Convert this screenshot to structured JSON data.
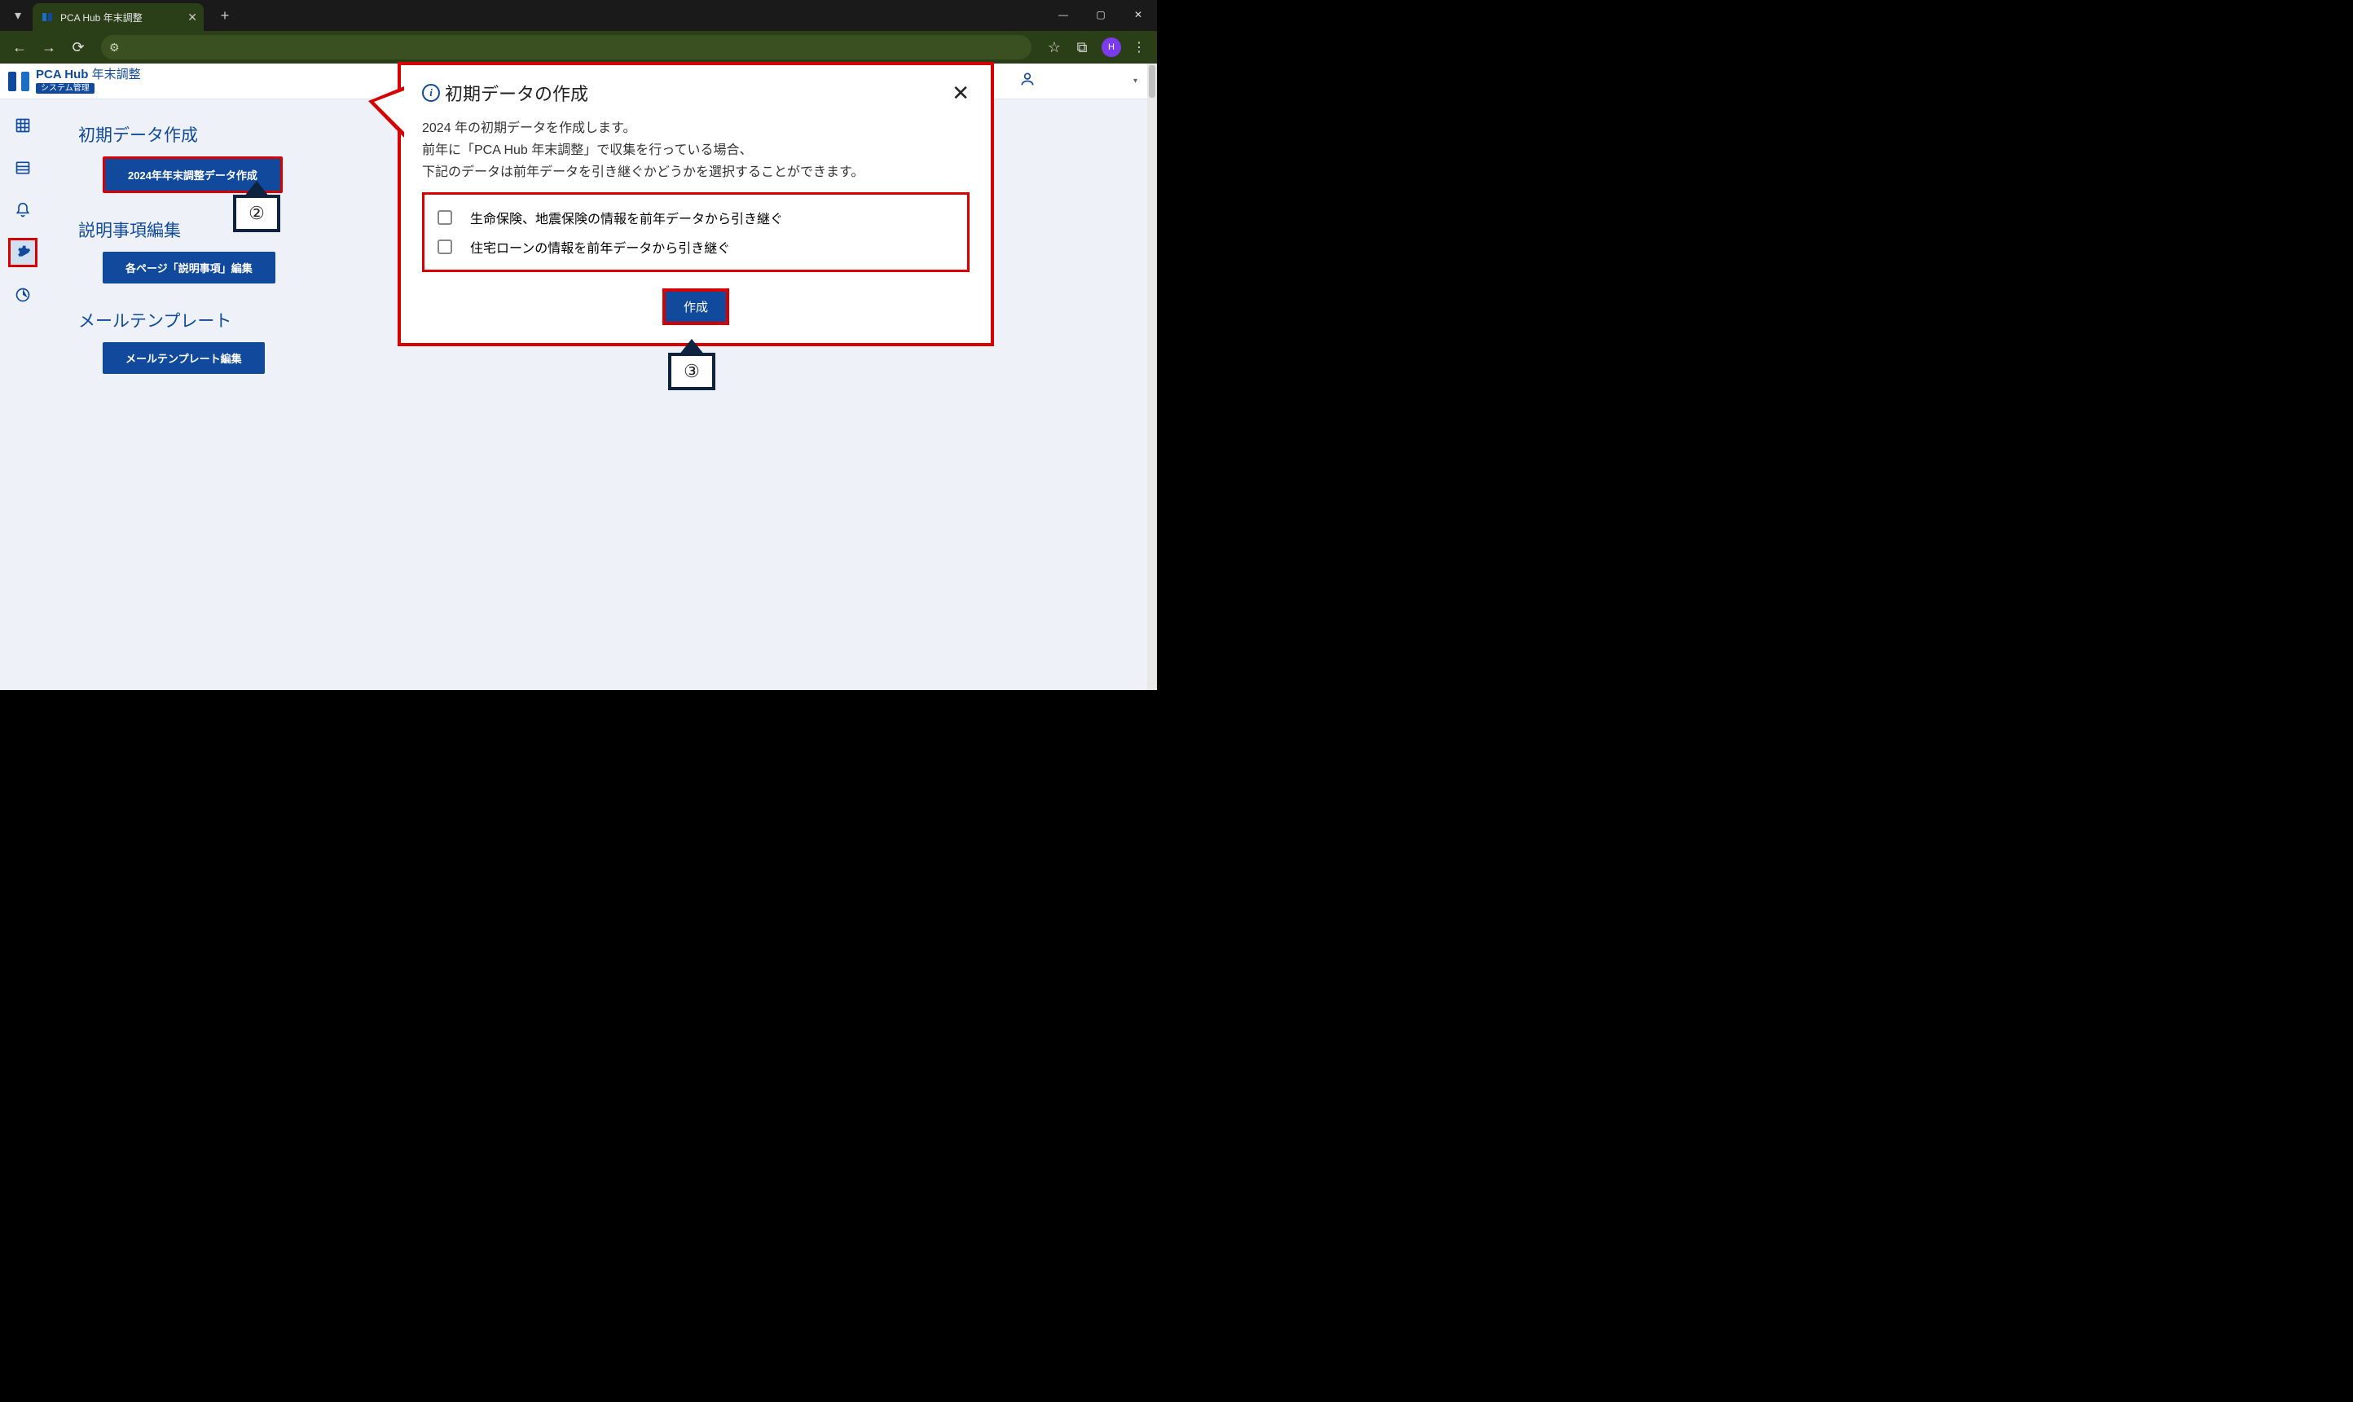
{
  "browser": {
    "tab_title": "PCA Hub 年末調整",
    "profile_initial": "H"
  },
  "app_header": {
    "brand": "PCA Hub",
    "brand_tail": "年末調整",
    "sub_label": "システム管理"
  },
  "sidebar": {
    "items": [
      {
        "name": "grid-icon"
      },
      {
        "name": "list-icon"
      },
      {
        "name": "bell-icon"
      },
      {
        "name": "gear-icon",
        "active": true
      },
      {
        "name": "pie-icon"
      }
    ]
  },
  "main": {
    "sections": [
      {
        "title": "初期データ作成",
        "button": "2024年年末調整データ作成",
        "outlined": true
      },
      {
        "title": "説明事項編集",
        "button": "各ページ「説明事項」編集",
        "outlined": false
      },
      {
        "title": "メールテンプレート",
        "button": "メールテンプレート編集",
        "outlined": false
      }
    ]
  },
  "dialog": {
    "title": "初期データの作成",
    "body_line1": "2024 年の初期データを作成します。",
    "body_line2": "前年に「PCA Hub 年末調整」で収集を行っている場合、",
    "body_line3": "下記のデータは前年データを引き継ぐかどうかを選択することができます。",
    "check1": "生命保険、地震保険の情報を前年データから引き継ぐ",
    "check2": "住宅ローンの情報を前年データから引き継ぐ",
    "create_label": "作成"
  },
  "annotations": {
    "num2": "②",
    "num3": "③"
  }
}
